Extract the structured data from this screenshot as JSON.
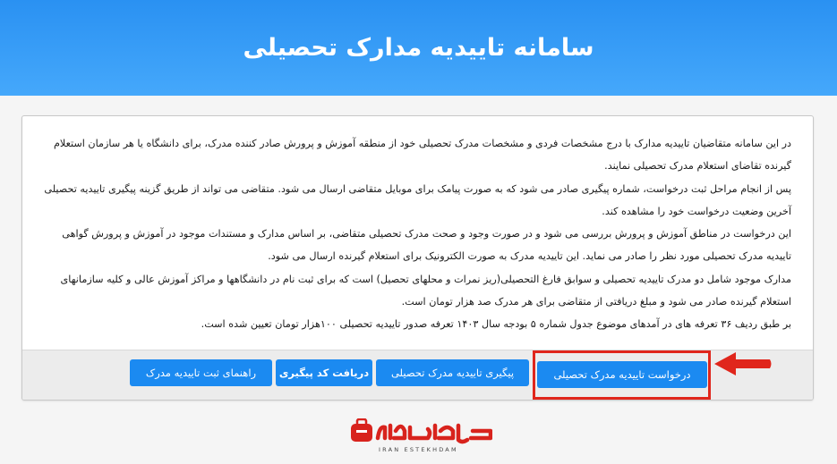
{
  "header": {
    "title": "سامانه تاییدیه مدارک تحصیلی"
  },
  "content": {
    "lines": [
      "در این سامانه متقاضیان تاییدیه مدارک با درج مشخصات فردی و مشخصات مدرک تحصیلی خود از منطقه آموزش و پرورش صادر کننده مدرک، برای دانشگاه یا هر سازمان استعلام گیرنده تقاضای استعلام مدرک تحصیلی نمایند.",
      "پس از انجام مراحل ثبت درخواست، شماره پیگیری صادر می شود که به صورت پیامک برای موبایل متقاضی ارسال می شود. متقاضی می تواند از طریق گزینه پیگیری تاییدیه تحصیلی آخرین وضعیت درخواست خود را مشاهده کند.",
      "این درخواست در مناطق آموزش و پرورش بررسی می شود و در صورت وجود و صحت مدرک تحصیلی متقاضی، بر اساس مدارک و مستندات موجود در آموزش و پرورش گواهی تاییدیه مدرک تحصیلی مورد نظر را صادر می نماید. این تاییدیه مدرک به صورت الکترونیک برای استعلام گیرنده ارسال می شود.",
      "مدارک موجود شامل دو مدرک تاییدیه تحصیلی و سوابق فارغ التحصیلی(ریز نمرات و محلهای تحصیل) است که برای ثبت نام در دانشگاهها و مراکز آموزش عالی و کلیه سازمانهای استعلام گیرنده صادر می شود و مبلغ دریافتی از متقاضی برای هر مدرک صد هزار تومان است.",
      "بر طبق ردیف ۳۶ تعرفه های در آمدهای موضوع جدول شماره ۵ بودجه سال ۱۴۰۳ تعرفه صدور تاییدیه تحصیلی ۱۰۰هزار تومان تعیین شده است."
    ]
  },
  "buttons": {
    "request": "درخواست تاییدیه مدرک تحصیلی",
    "track": "پیگیری تاییدیه مدرک تحصیلی",
    "get_code": "دریافت کد پیگیری",
    "guide": "راهنمای ثبت تاییدیه مدرک"
  },
  "logo": {
    "text": "ایران استخدام",
    "subtext": "IRAN ESTEKHDAM"
  },
  "colors": {
    "header": "#2a91f2",
    "button": "#1b8af1",
    "annotation": "#e0261c"
  }
}
